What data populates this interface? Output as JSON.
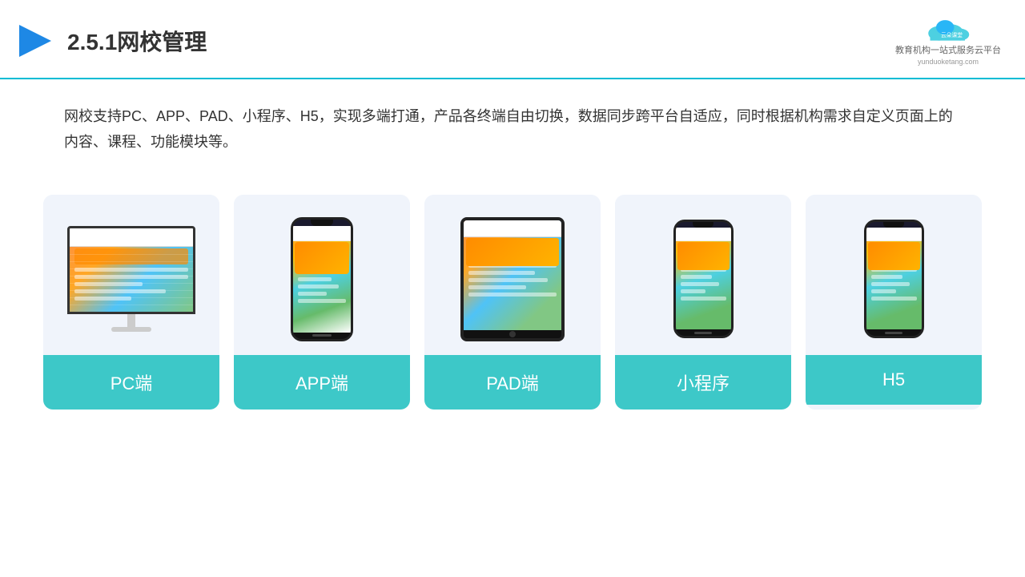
{
  "header": {
    "title": "2.5.1网校管理",
    "logo": {
      "name": "云朵课堂",
      "url": "yunduoketang.com",
      "tagline": "教育机构一站\n式服务云平台"
    }
  },
  "description": {
    "text": "网校支持PC、APP、PAD、小程序、H5，实现多端打通，产品各终端自由切换，数据同步跨平台自适应，同时根据机构需求自定义页面上的内容、课程、功能模块等。"
  },
  "cards": [
    {
      "id": "pc",
      "label": "PC端"
    },
    {
      "id": "app",
      "label": "APP端"
    },
    {
      "id": "pad",
      "label": "PAD端"
    },
    {
      "id": "miniapp",
      "label": "小程序"
    },
    {
      "id": "h5",
      "label": "H5"
    }
  ],
  "colors": {
    "accent": "#3dc8c8",
    "headerBorder": "#00bcd4",
    "cardBg": "#f0f4fb",
    "text": "#333333"
  }
}
